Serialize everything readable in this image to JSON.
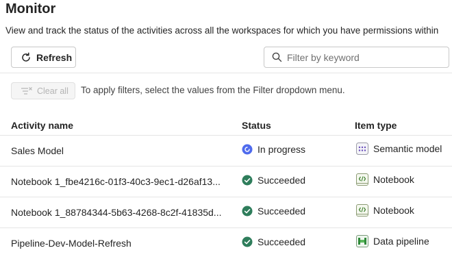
{
  "page": {
    "title": "Monitor",
    "description": "View and track the status of the activities across all the workspaces for which you have permissions within"
  },
  "toolbar": {
    "refresh_label": "Refresh",
    "refresh_icon": "refresh-icon",
    "search_placeholder": "Filter by keyword",
    "search_value": "",
    "search_icon": "search-icon"
  },
  "filters": {
    "clear_all_label": "Clear all",
    "clear_all_icon": "filter-clear-icon",
    "hint": "To apply filters, select the values from the Filter dropdown menu."
  },
  "table": {
    "columns": [
      "Activity name",
      "Status",
      "Item type"
    ],
    "rows": [
      {
        "name": "Sales Model",
        "status": "In progress",
        "status_icon": "in-progress-icon",
        "status_color": "#4f6bed",
        "item_type": "Semantic model",
        "type_icon": "semantic-model-icon"
      },
      {
        "name": "Notebook 1_fbe4216c-01f3-40c3-9ec1-d26af13...",
        "status": "Succeeded",
        "status_icon": "succeeded-icon",
        "status_color": "#2e7d5b",
        "item_type": "Notebook",
        "type_icon": "notebook-icon"
      },
      {
        "name": "Notebook 1_88784344-5b63-4268-8c2f-41835d...",
        "status": "Succeeded",
        "status_icon": "succeeded-icon",
        "status_color": "#2e7d5b",
        "item_type": "Notebook",
        "type_icon": "notebook-icon"
      },
      {
        "name": "Pipeline-Dev-Model-Refresh",
        "status": "Succeeded",
        "status_icon": "succeeded-icon",
        "status_color": "#2e7d5b",
        "item_type": "Data pipeline",
        "type_icon": "data-pipeline-icon"
      }
    ]
  },
  "colors": {
    "text": "#242424",
    "border": "#c8c8c8",
    "in_progress": "#4f6bed",
    "succeeded": "#2e7d5b"
  }
}
